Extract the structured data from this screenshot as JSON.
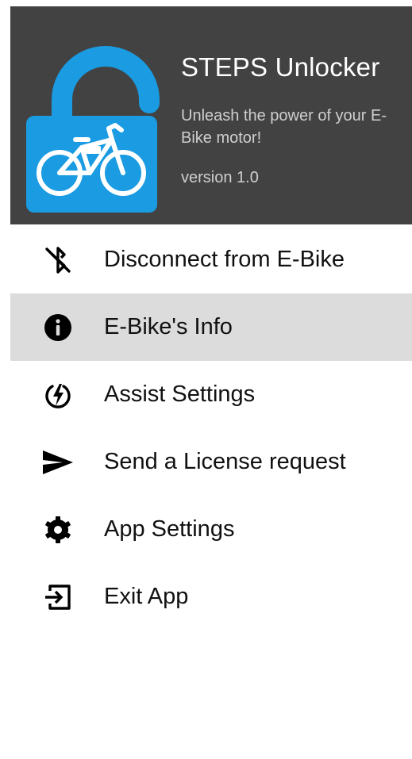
{
  "header": {
    "title": "STEPS Unlocker",
    "tagline": "Unleash the power of your E-Bike motor!",
    "version": "version 1.0",
    "logo_icon": "unlocked-padlock-bike-icon",
    "background_color": "#424242",
    "logo_color": "#1a9be2"
  },
  "menu": {
    "selected_index": 1,
    "items": [
      {
        "label": "Disconnect from E-Bike",
        "icon": "bluetooth-disabled-icon"
      },
      {
        "label": "E-Bike's Info",
        "icon": "info-icon"
      },
      {
        "label": "Assist Settings",
        "icon": "lightning-bolt-icon"
      },
      {
        "label": "Send a License request",
        "icon": "send-icon"
      },
      {
        "label": "App Settings",
        "icon": "gear-icon"
      },
      {
        "label": "Exit App",
        "icon": "exit-icon"
      }
    ]
  }
}
